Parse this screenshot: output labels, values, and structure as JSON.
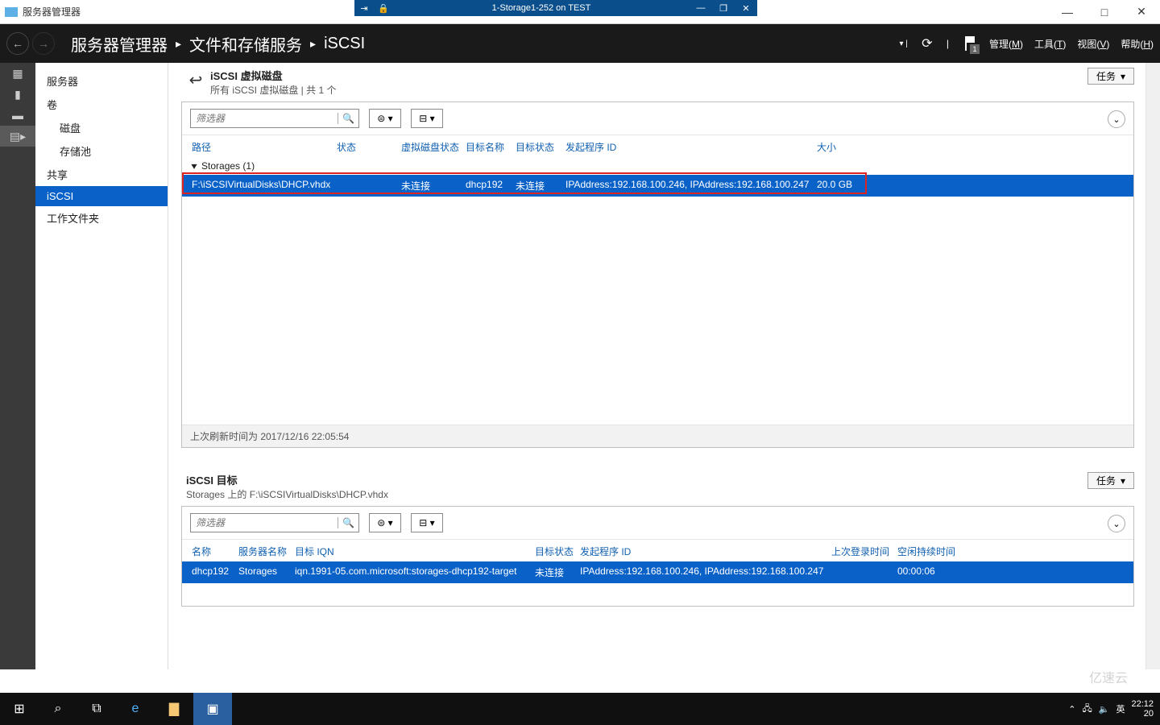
{
  "os": {
    "title": "服务器管理器",
    "min": "—",
    "max": "□",
    "close": "✕"
  },
  "rdp": {
    "title": "1-Storage1-252 on TEST",
    "min": "—",
    "max": "❐",
    "close": "✕"
  },
  "header": {
    "crumb1": "服务器管理器",
    "crumb2": "文件和存储服务",
    "crumb3": "iSCSI",
    "menu_manage": "管理(",
    "menu_manage_u": "M",
    "menu_manage2": ")",
    "menu_tools": "工具(",
    "menu_tools_u": "T",
    "menu_tools2": ")",
    "menu_view": "视图(",
    "menu_view_u": "V",
    "menu_view2": ")",
    "menu_help": "帮助(",
    "menu_help_u": "H",
    "menu_help2": ")",
    "flag_count": "1"
  },
  "sidebar": {
    "items": [
      {
        "label": "服务器"
      },
      {
        "label": "卷"
      },
      {
        "label": "磁盘",
        "sub": true
      },
      {
        "label": "存储池",
        "sub": true
      },
      {
        "label": "共享"
      },
      {
        "label": "iSCSI",
        "active": true
      },
      {
        "label": "工作文件夹"
      }
    ]
  },
  "panel1": {
    "title": "iSCSI 虚拟磁盘",
    "subtitle": "所有 iSCSI 虚拟磁盘 | 共 1 个",
    "tasks": "任务",
    "filter_ph": "筛选器",
    "cols": {
      "path": "路径",
      "stat": "状态",
      "vdisk": "虚拟磁盘状态",
      "tname": "目标名称",
      "tstat": "目标状态",
      "init": "发起程序 ID",
      "size": "大小"
    },
    "group": "Storages (1)",
    "row": {
      "path": "F:\\iSCSIVirtualDisks\\DHCP.vhdx",
      "stat": "",
      "vdisk": "未连接",
      "tname": "dhcp192",
      "tstat": "未连接",
      "init": "IPAddress:192.168.100.246, IPAddress:192.168.100.247",
      "size": "20.0 GB"
    },
    "footer": "上次刷新时间为 2017/12/16 22:05:54"
  },
  "panel2": {
    "title": "iSCSI 目标",
    "subtitle": "Storages 上的 F:\\iSCSIVirtualDisks\\DHCP.vhdx",
    "tasks": "任务",
    "filter_ph": "筛选器",
    "cols": {
      "name": "名称",
      "srv": "服务器名称",
      "iqn": "目标 IQN",
      "tstat": "目标状态",
      "init": "发起程序 ID",
      "last": "上次登录时间",
      "idle": "空闲持续时间"
    },
    "row": {
      "name": "dhcp192",
      "srv": "Storages",
      "iqn": "iqn.1991-05.com.microsoft:storages-dhcp192-target",
      "tstat": "未连接",
      "init": "IPAddress:192.168.100.246, IPAddress:192.168.100.247",
      "last": "",
      "idle": "00:00:06"
    }
  },
  "tray": {
    "ime": "英",
    "time": "22:12",
    "date": "20"
  },
  "watermark": "亿速云"
}
